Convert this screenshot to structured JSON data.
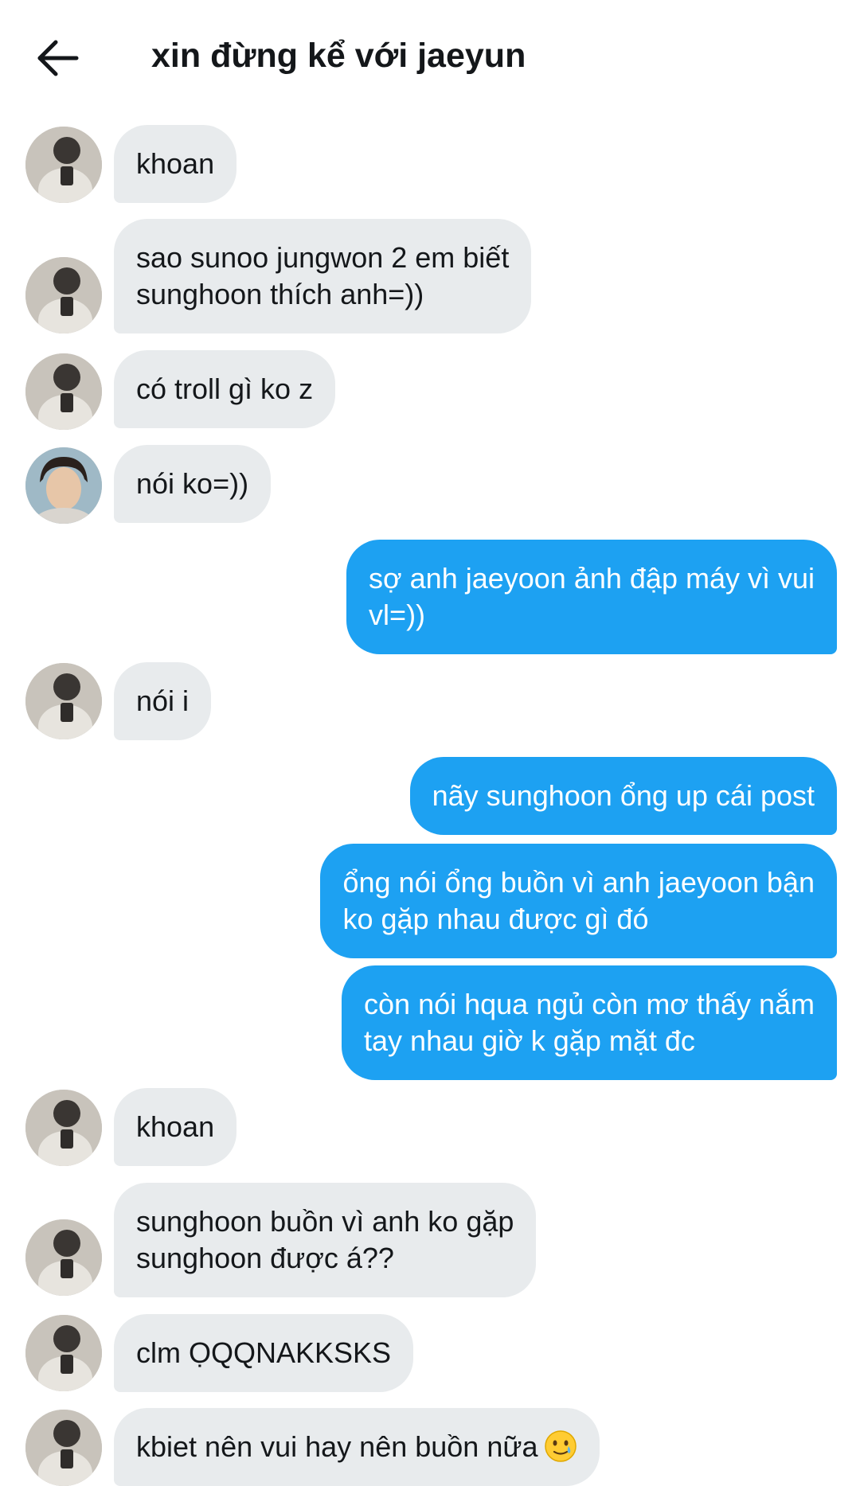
{
  "header": {
    "title": "xin đừng kể với jaeyun"
  },
  "messages": [
    {
      "side": "in",
      "text": "khoan",
      "avatar": "photo-avatar"
    },
    {
      "side": "in",
      "text": "sao sunoo jungwon 2 em biết\nsunghoon thích anh=))",
      "avatar": "photo-avatar"
    },
    {
      "side": "in",
      "text": "có troll gì ko z",
      "avatar": "photo-avatar"
    },
    {
      "side": "in",
      "text": "nói ko=))",
      "avatar": "portrait-avatar"
    },
    {
      "side": "out",
      "text": "sợ anh jaeyoon ảnh đập máy vì vui\nvl=))"
    },
    {
      "side": "in",
      "text": "nói i",
      "avatar": "photo-avatar"
    },
    {
      "side": "out",
      "text": "nãy sunghoon ổng up cái post"
    },
    {
      "side": "out",
      "text": "ổng nói ổng buồn vì anh jaeyoon bận\nko gặp nhau được gì đó"
    },
    {
      "side": "out",
      "text": "còn nói hqua ngủ còn mơ thấy nắm\ntay nhau giờ k gặp mặt đc"
    },
    {
      "side": "in",
      "text": "khoan",
      "avatar": "photo-avatar"
    },
    {
      "side": "in",
      "text": "sunghoon buồn vì anh ko gặp\nsunghoon được á??",
      "avatar": "photo-avatar"
    },
    {
      "side": "in",
      "text": "clm ỌQQNAKKSKS",
      "avatar": "photo-avatar"
    },
    {
      "side": "in",
      "text": "kbiet nên vui hay nên buồn nữa",
      "avatar": "photo-avatar",
      "emoji": "smiling-face-with-tear-emoji"
    }
  ],
  "colors": {
    "incoming_bubble": "#e8ebed",
    "outgoing_bubble": "#1da1f2",
    "text": "#14171a"
  }
}
